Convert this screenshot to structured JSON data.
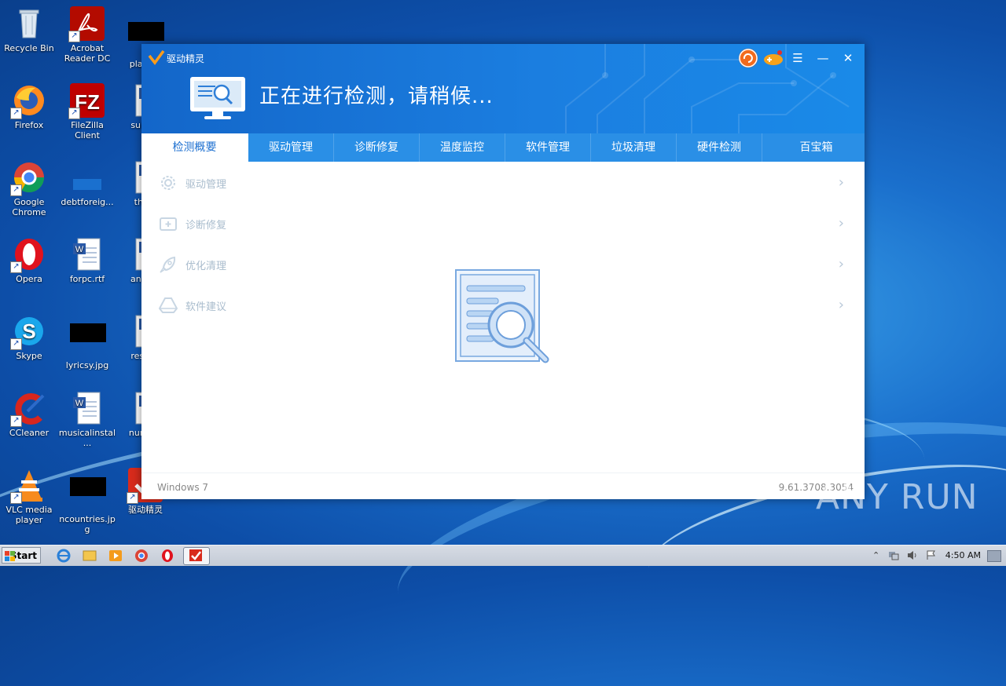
{
  "desktop": {
    "icons": [
      {
        "label": "Recycle Bin"
      },
      {
        "label": "Acrobat Reader DC"
      },
      {
        "label": "playe..."
      },
      {
        "label": "Firefox"
      },
      {
        "label": "FileZilla Client"
      },
      {
        "label": "suite..."
      },
      {
        "label": "Google Chrome"
      },
      {
        "label": "debtforeig..."
      },
      {
        "label": "thu..."
      },
      {
        "label": "Opera"
      },
      {
        "label": "forpc.rtf"
      },
      {
        "label": "answ..."
      },
      {
        "label": "Skype"
      },
      {
        "label": "lyricsy.jpg"
      },
      {
        "label": "resul..."
      },
      {
        "label": "CCleaner"
      },
      {
        "label": "musicalinstal..."
      },
      {
        "label": "numb..."
      },
      {
        "label": "VLC media player"
      },
      {
        "label": "ncountries.jpg"
      },
      {
        "label": "驱动精灵"
      }
    ]
  },
  "app": {
    "title": "驱动精灵",
    "headline": "正在进行检测，请稍候...",
    "tabs": [
      {
        "label": "检测概要",
        "active": true
      },
      {
        "label": "驱动管理"
      },
      {
        "label": "诊断修复"
      },
      {
        "label": "温度监控"
      },
      {
        "label": "软件管理"
      },
      {
        "label": "垃圾清理"
      },
      {
        "label": "硬件检测"
      },
      {
        "label": "百宝箱"
      }
    ],
    "rows": [
      {
        "label": "驱动管理",
        "icon": "gear-icon"
      },
      {
        "label": "诊断修复",
        "icon": "medical-kit-icon"
      },
      {
        "label": "优化清理",
        "icon": "rocket-icon"
      },
      {
        "label": "软件建议",
        "icon": "drive-icon"
      }
    ],
    "footer": {
      "os": "Windows 7",
      "version": "9.61.3708.3054"
    },
    "controls": {
      "menu": "☰",
      "minimize": "—",
      "close": "✕"
    }
  },
  "watermark": "ANY RUN",
  "taskbar": {
    "start_label": "Start",
    "clock": "4:50 AM"
  },
  "colors": {
    "header_blue": "#1366c9",
    "tab_blue": "#2a8fe6",
    "active_tab_text": "#1c6fd0"
  }
}
